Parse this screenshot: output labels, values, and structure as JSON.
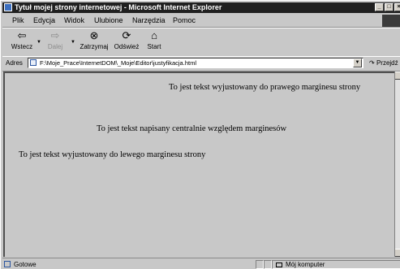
{
  "window": {
    "title": "Tytuł mojej strony internetowej - Microsoft Internet Explorer",
    "controls": {
      "minimize": "_",
      "maximize": "□",
      "close": "×"
    }
  },
  "menu": [
    {
      "label": "Plik",
      "icon": ""
    },
    {
      "label": "Edycja"
    },
    {
      "label": "Widok"
    },
    {
      "label": "Ulubione"
    },
    {
      "label": "Narzędzia"
    },
    {
      "label": "Pomoc"
    }
  ],
  "toolbar": {
    "back": {
      "label": "Wstecz",
      "icon": "back-arrow-icon"
    },
    "forward": {
      "label": "Dalej",
      "icon": "forward-arrow-icon"
    },
    "stop": {
      "label": "Zatrzymaj",
      "icon": "stop-icon"
    },
    "refresh": {
      "label": "Odśwież",
      "icon": "refresh-icon"
    },
    "home": {
      "label": "Start",
      "icon": "home-icon"
    }
  },
  "address": {
    "label": "Adres",
    "value": "F:\\Moje_Prace\\InternetDOM\\_Moje\\Editor\\justyfikacja.html",
    "go_label": "Przejdź"
  },
  "content": {
    "right_text": "To jest tekst wyjustowany do prawego marginesu strony",
    "center_text": "To jest tekst napisany centralnie względem marginesów",
    "left_text": "To jest tekst wyjustowany do lewego marginesu strony"
  },
  "status": {
    "text": "Gotowe",
    "zone": "Mój komputer"
  }
}
